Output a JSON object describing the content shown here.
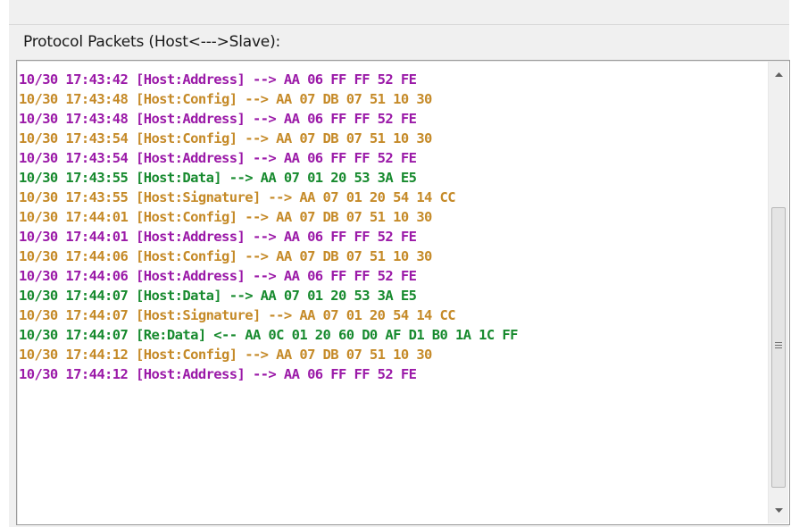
{
  "panel": {
    "title": "Protocol Packets (Host<--->Slave):"
  },
  "colors": {
    "address": "#9b1aa8",
    "config": "#c58a28",
    "data": "#178a2e",
    "signature": "#c58a28",
    "reply": "#178a2e"
  },
  "log": {
    "lines": [
      {
        "text": "10/30 17:43:42 [Host:Address] --> AA 06 FF FF 52 FE",
        "kind": "address"
      },
      {
        "text": "10/30 17:43:48 [Host:Config] --> AA 07 DB 07 51 10 30",
        "kind": "config"
      },
      {
        "text": "10/30 17:43:48 [Host:Address] --> AA 06 FF FF 52 FE",
        "kind": "address"
      },
      {
        "text": "10/30 17:43:54 [Host:Config] --> AA 07 DB 07 51 10 30",
        "kind": "config"
      },
      {
        "text": "10/30 17:43:54 [Host:Address] --> AA 06 FF FF 52 FE",
        "kind": "address"
      },
      {
        "text": "10/30 17:43:55 [Host:Data] --> AA 07 01 20 53 3A E5",
        "kind": "data"
      },
      {
        "text": "10/30 17:43:55 [Host:Signature] --> AA 07 01 20 54 14 CC",
        "kind": "signature"
      },
      {
        "text": "10/30 17:44:01 [Host:Config] --> AA 07 DB 07 51 10 30",
        "kind": "config"
      },
      {
        "text": "10/30 17:44:01 [Host:Address] --> AA 06 FF FF 52 FE",
        "kind": "address"
      },
      {
        "text": "10/30 17:44:06 [Host:Config] --> AA 07 DB 07 51 10 30",
        "kind": "config"
      },
      {
        "text": "10/30 17:44:06 [Host:Address] --> AA 06 FF FF 52 FE",
        "kind": "address"
      },
      {
        "text": "10/30 17:44:07 [Host:Data] --> AA 07 01 20 53 3A E5",
        "kind": "data"
      },
      {
        "text": "10/30 17:44:07 [Host:Signature] --> AA 07 01 20 54 14 CC",
        "kind": "signature"
      },
      {
        "text": "10/30 17:44:07 [Re:Data] <-- AA 0C 01 20 60 D0 AF D1 B0 1A 1C FF",
        "kind": "reply"
      },
      {
        "text": "10/30 17:44:12 [Host:Config] --> AA 07 DB 07 51 10 30",
        "kind": "config"
      },
      {
        "text": "10/30 17:44:12 [Host:Address] --> AA 06 FF FF 52 FE",
        "kind": "address"
      }
    ]
  },
  "scrollbar": {
    "up_icon": "up-arrow-icon",
    "down_icon": "down-arrow-icon",
    "thumb_grip_icon": "grip-icon",
    "position": 0.62
  }
}
